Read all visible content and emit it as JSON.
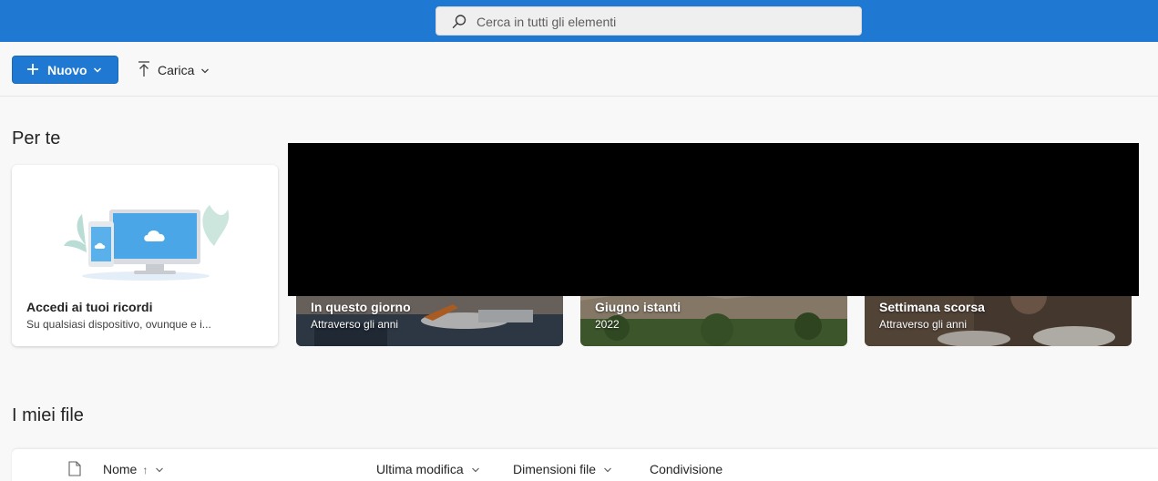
{
  "topbar": {
    "search": {
      "placeholder": "Cerca in tutti gli elementi"
    }
  },
  "commandbar": {
    "new_label": "Nuovo",
    "upload_label": "Carica"
  },
  "for_you": {
    "title": "Per te",
    "memories_card": {
      "title": "Accedi ai tuoi ricordi",
      "subtitle": "Su qualsiasi dispositivo, ovunque e i..."
    },
    "photo_cards": [
      {
        "title": "In questo giorno",
        "subtitle": "Attraverso gli anni"
      },
      {
        "title": "Giugno istanti",
        "subtitle": "2022"
      },
      {
        "title": "Settimana scorsa",
        "subtitle": "Attraverso gli anni"
      }
    ]
  },
  "my_files": {
    "title": "I miei file",
    "columns": {
      "name": "Nome",
      "name_sort": "↑",
      "modified": "Ultima modifica",
      "size": "Dimensioni file",
      "sharing": "Condivisione"
    }
  },
  "colors": {
    "accent": "#1f78d1",
    "background": "#f8f8f8",
    "redaction": "#000000"
  },
  "icons": [
    "search-icon",
    "plus-icon",
    "chevron-down-icon",
    "upload-arrow-icon",
    "document-icon",
    "devices-cloud-illustration"
  ]
}
